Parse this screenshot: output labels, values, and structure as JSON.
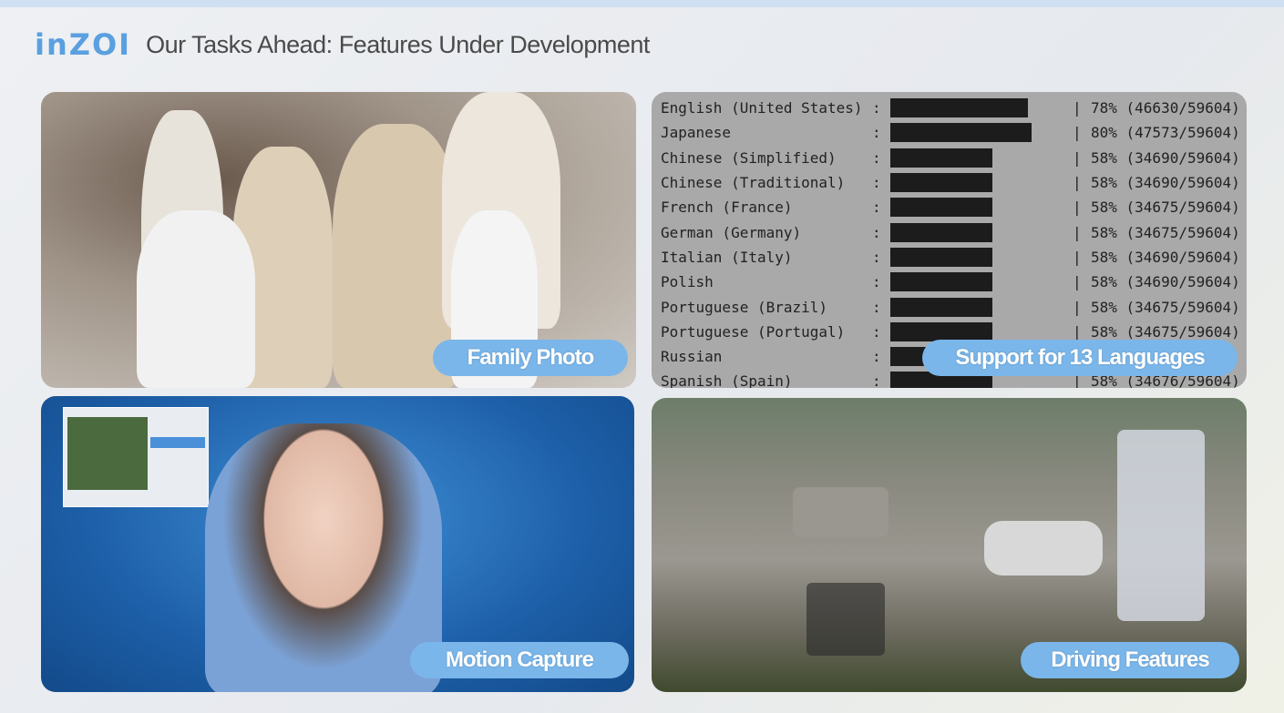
{
  "header": {
    "logo": "inZOI",
    "title": "Our Tasks Ahead: Features Under Development"
  },
  "panels": [
    {
      "label": "Family Photo"
    },
    {
      "label": "Support for 13 Languages"
    },
    {
      "label": "Motion Capture"
    },
    {
      "label": "Driving Features"
    }
  ],
  "languages": [
    {
      "name": "English (United States)",
      "percent": 78,
      "text": "78% (46630/59604)"
    },
    {
      "name": "Japanese",
      "percent": 80,
      "text": "80% (47573/59604)"
    },
    {
      "name": "Chinese (Simplified)",
      "percent": 58,
      "text": "58% (34690/59604)"
    },
    {
      "name": "Chinese (Traditional)",
      "percent": 58,
      "text": "58% (34690/59604)"
    },
    {
      "name": "French (France)",
      "percent": 58,
      "text": "58% (34675/59604)"
    },
    {
      "name": "German (Germany)",
      "percent": 58,
      "text": "58% (34675/59604)"
    },
    {
      "name": "Italian (Italy)",
      "percent": 58,
      "text": "58% (34690/59604)"
    },
    {
      "name": "Polish",
      "percent": 58,
      "text": "58% (34690/59604)"
    },
    {
      "name": "Portuguese (Brazil)",
      "percent": 58,
      "text": "58% (34675/59604)"
    },
    {
      "name": "Portuguese (Portugal)",
      "percent": 58,
      "text": "58% (34675/59604)"
    },
    {
      "name": "Russian",
      "percent": 58,
      "text": ""
    },
    {
      "name": "Spanish (Spain)",
      "percent": 58,
      "text": "58% (34676/59604)"
    }
  ],
  "colors": {
    "accent": "#7ab6ea",
    "logo": "#5aa0e0",
    "title": "#4a4a4a"
  }
}
